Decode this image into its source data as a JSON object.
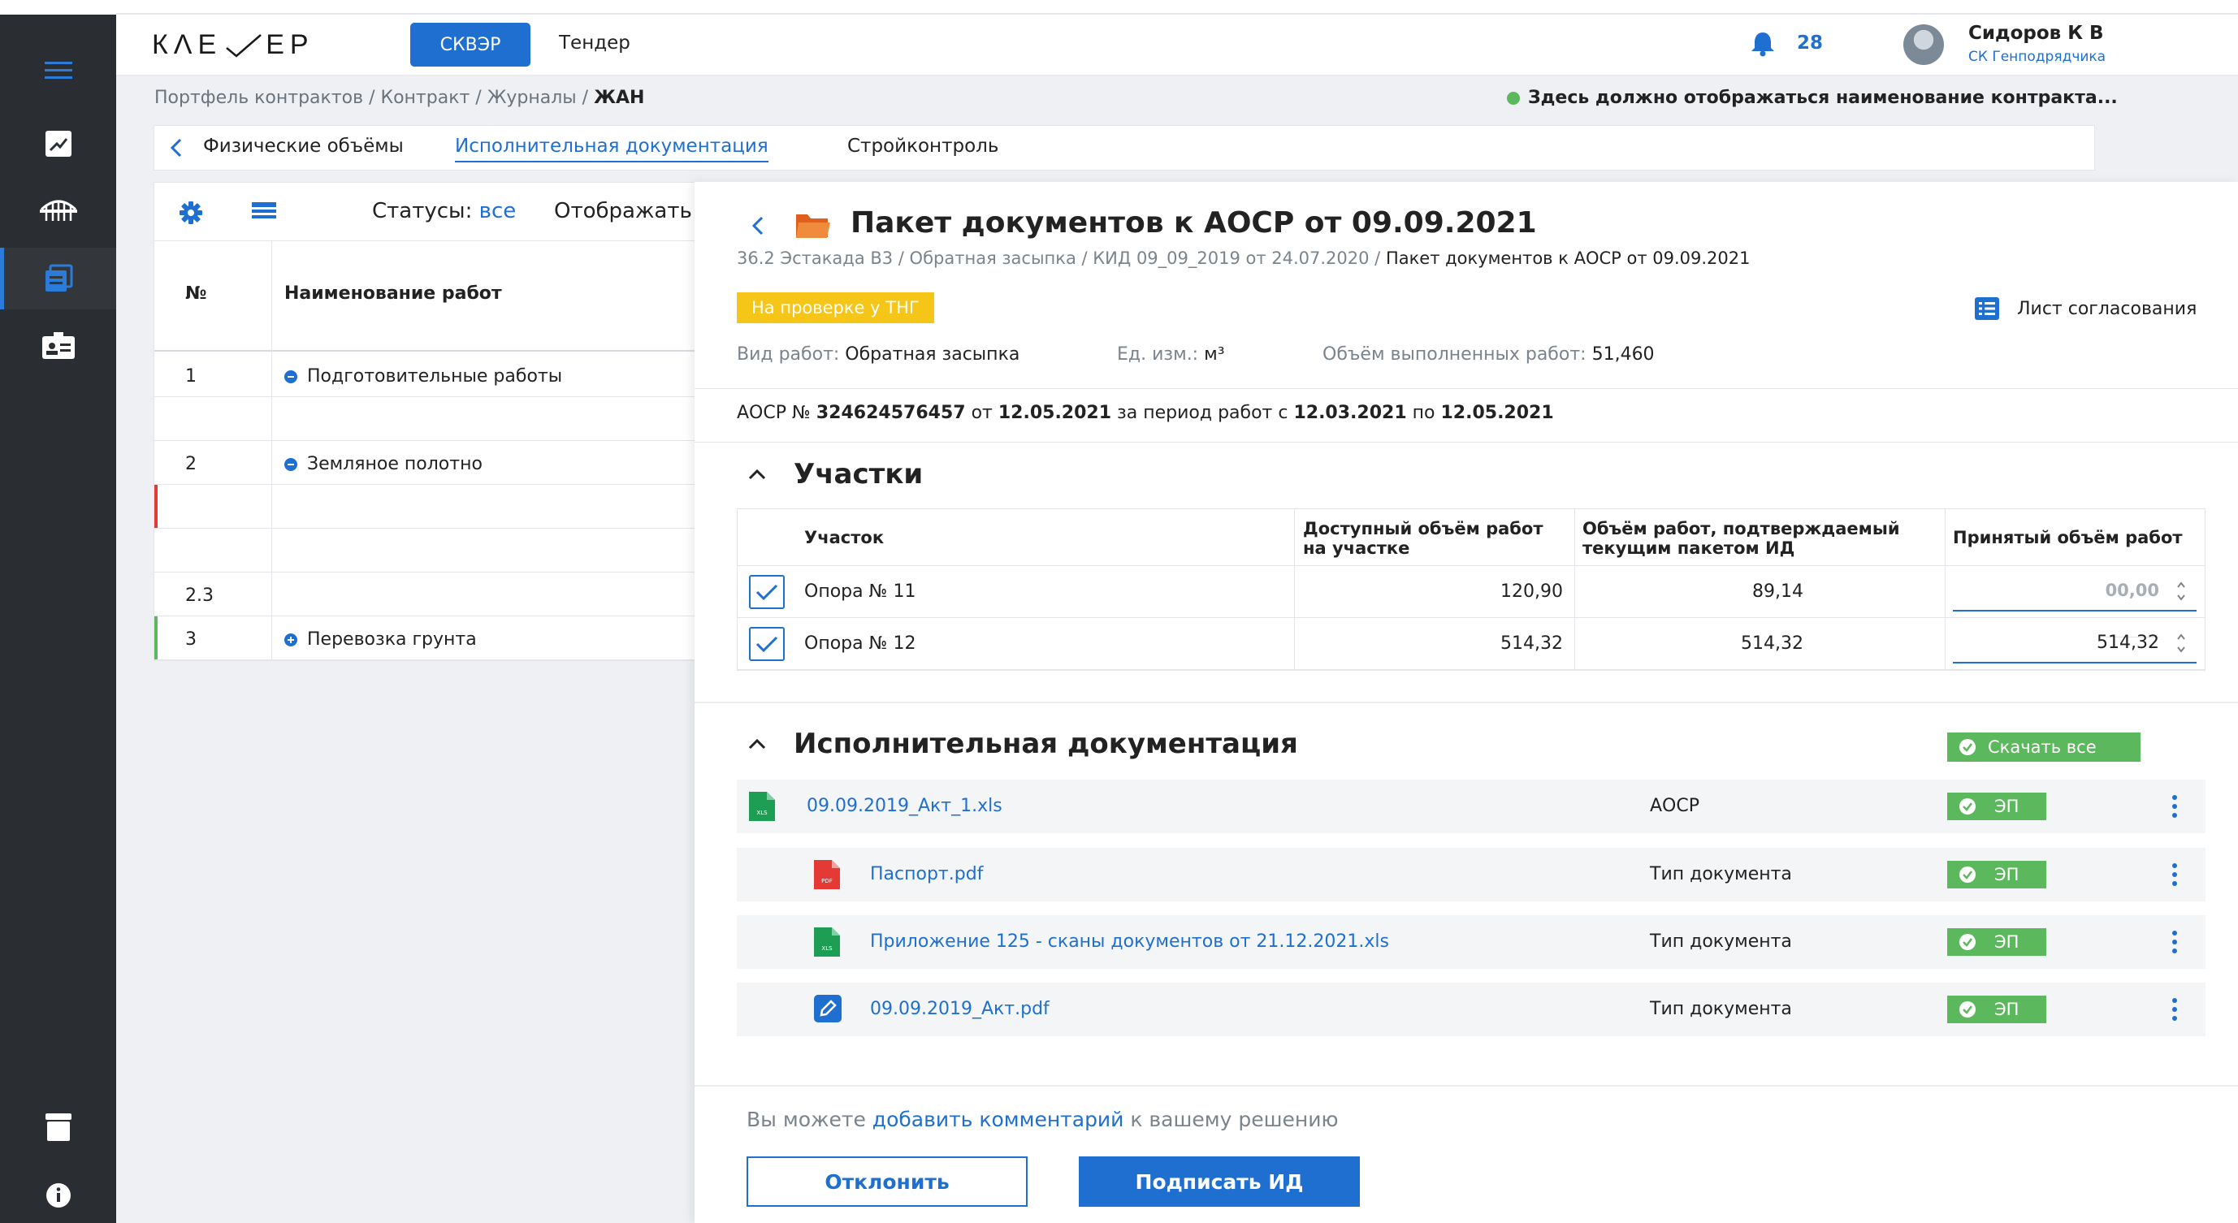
{
  "header": {
    "logo_left": "КΛЕ",
    "logo_right": "ЕР",
    "skver_label": "СКВЭР",
    "tender_label": "Тендер",
    "notifications_count": "28",
    "user_name": "Сидоров К В",
    "user_role": "СК Генподрядчика"
  },
  "breadcrumb": {
    "path": "Портфель контрактов / Контракт / Журналы / ",
    "current": "ЖАН"
  },
  "contract_name": "Здесь должно отображаться наименование контракта...",
  "tabs": [
    {
      "label": "Физические объёмы"
    },
    {
      "label": "Исполнительная документация"
    },
    {
      "label": "Стройконтроль"
    }
  ],
  "left_table": {
    "statuses_label": "Статусы:",
    "statuses_value": "все",
    "show_label": "Отображать",
    "col_num": "№",
    "col_name": "Наименование работ",
    "rows": [
      {
        "num": "1",
        "name": "Подготовительные работы"
      },
      {
        "num": "",
        "name": ""
      },
      {
        "num": "2",
        "name": "Земляное полотно"
      },
      {
        "num": "",
        "name": ""
      },
      {
        "num": "",
        "name": ""
      },
      {
        "num": "2.3",
        "name": ""
      },
      {
        "num": "3",
        "name": "Перевозка грунта"
      }
    ]
  },
  "panel": {
    "title": "Пакет документов к АОСР от 09.09.2021",
    "path_prefix": "36.2 Эстакада В3 / Обратная засыпка / КИД 09_09_2019 от 24.07.2020 / ",
    "path_current": "Пакет документов к АОСР от 09.09.2021",
    "status_badge": "На проверке у ТНГ",
    "approval_sheet": "Лист согласования",
    "work_type_label": "Вид работ:",
    "work_type_value": "Обратная засыпка",
    "unit_label": "Ед. изм.:",
    "unit_value": "м³",
    "volume_label": "Объём выполненных работ:",
    "volume_value": "51,460",
    "aosr": {
      "prefix": "АОСР №",
      "number": "324624576457",
      "from": "от",
      "date": "12.05.2021",
      "period": "за период работ с",
      "period_start": "12.03.2021",
      "to": "по",
      "period_end": "12.05.2021"
    },
    "sections_title": "Участки",
    "sections_table": {
      "col_section": "Участок",
      "col_available_1": "Доступный объём работ",
      "col_available_2": "на участке",
      "col_confirmed_1": "Объём работ, подтверждаемый",
      "col_confirmed_2": "текущим пакетом ИД",
      "col_accepted": "Принятый объём работ",
      "rows": [
        {
          "name": "Опора № 11",
          "available": "120,90",
          "confirmed": "89,14",
          "accepted_placeholder": "00,00",
          "accepted": ""
        },
        {
          "name": "Опора № 12",
          "available": "514,32",
          "confirmed": "514,32",
          "accepted_placeholder": "",
          "accepted": "514,32"
        }
      ]
    },
    "docs_title": "Исполнительная документация",
    "download_all": "Скачать все",
    "documents": [
      {
        "name": "09.09.2019_Акт_1.xls",
        "type": "АОСР",
        "icon": "xls-file-icon",
        "ep": "ЭП",
        "icon_label": "XLS"
      },
      {
        "name": "Паспорт.pdf",
        "type": "Тип документа",
        "icon": "pdf-file-icon",
        "ep": "ЭП",
        "icon_label": "PDF"
      },
      {
        "name": "Приложение 125 - сканы документов от 21.12.2021.xls",
        "type": "Тип документа",
        "icon": "xls-file-icon",
        "ep": "ЭП",
        "icon_label": "XLS"
      },
      {
        "name": "09.09.2019_Акт.pdf",
        "type": "Тип документа",
        "icon": "edit-document-icon",
        "ep": "ЭП"
      }
    ],
    "comment_prefix": "Вы можете ",
    "comment_link": "добавить комментарий",
    "comment_suffix": " к вашему решению",
    "reject_label": "Отклонить",
    "sign_label": "Подписать ИД"
  },
  "colors": {
    "accent": "#1f6fd1",
    "nav_bg": "#2a2d31",
    "success": "#5cb85c",
    "warning": "#f5c518",
    "danger": "#e53935"
  }
}
